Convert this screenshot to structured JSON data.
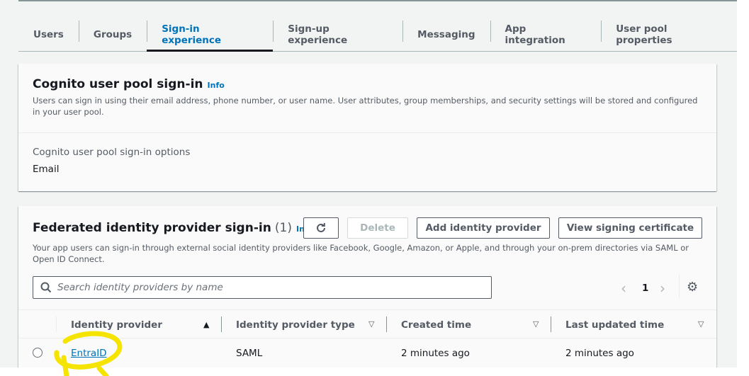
{
  "tabs": [
    "Users",
    "Groups",
    "Sign-in experience",
    "Sign-up experience",
    "Messaging",
    "App integration",
    "User pool properties"
  ],
  "active_tab": "Sign-in experience",
  "cognito": {
    "title": "Cognito user pool sign-in",
    "info": "Info",
    "description": "Users can sign in using their email address, phone number, or user name. User attributes, group memberships, and security settings will be stored and configured in your user pool.",
    "options_label": "Cognito user pool sign-in options",
    "options_value": "Email"
  },
  "federated": {
    "title": "Federated identity provider sign-in",
    "count": "(1)",
    "info": "Info",
    "refresh_icon": "refresh-icon",
    "delete_label": "Delete",
    "add_label": "Add identity provider",
    "view_cert_label": "View signing certificate",
    "description": "Your app users can sign-in through external social identity providers like Facebook, Google, Amazon, or Apple, and through your on-prem directories via SAML or Open ID Connect.",
    "search_placeholder": "Search identity providers by name",
    "page": "1",
    "columns": [
      "Identity provider",
      "Identity provider type",
      "Created time",
      "Last updated time"
    ],
    "rows": [
      {
        "name": "EntraID",
        "type": "SAML",
        "created": "2 minutes ago",
        "updated": "2 minutes ago"
      }
    ]
  },
  "colors": {
    "link": "#0073bb",
    "highlight": "#f5e400"
  }
}
